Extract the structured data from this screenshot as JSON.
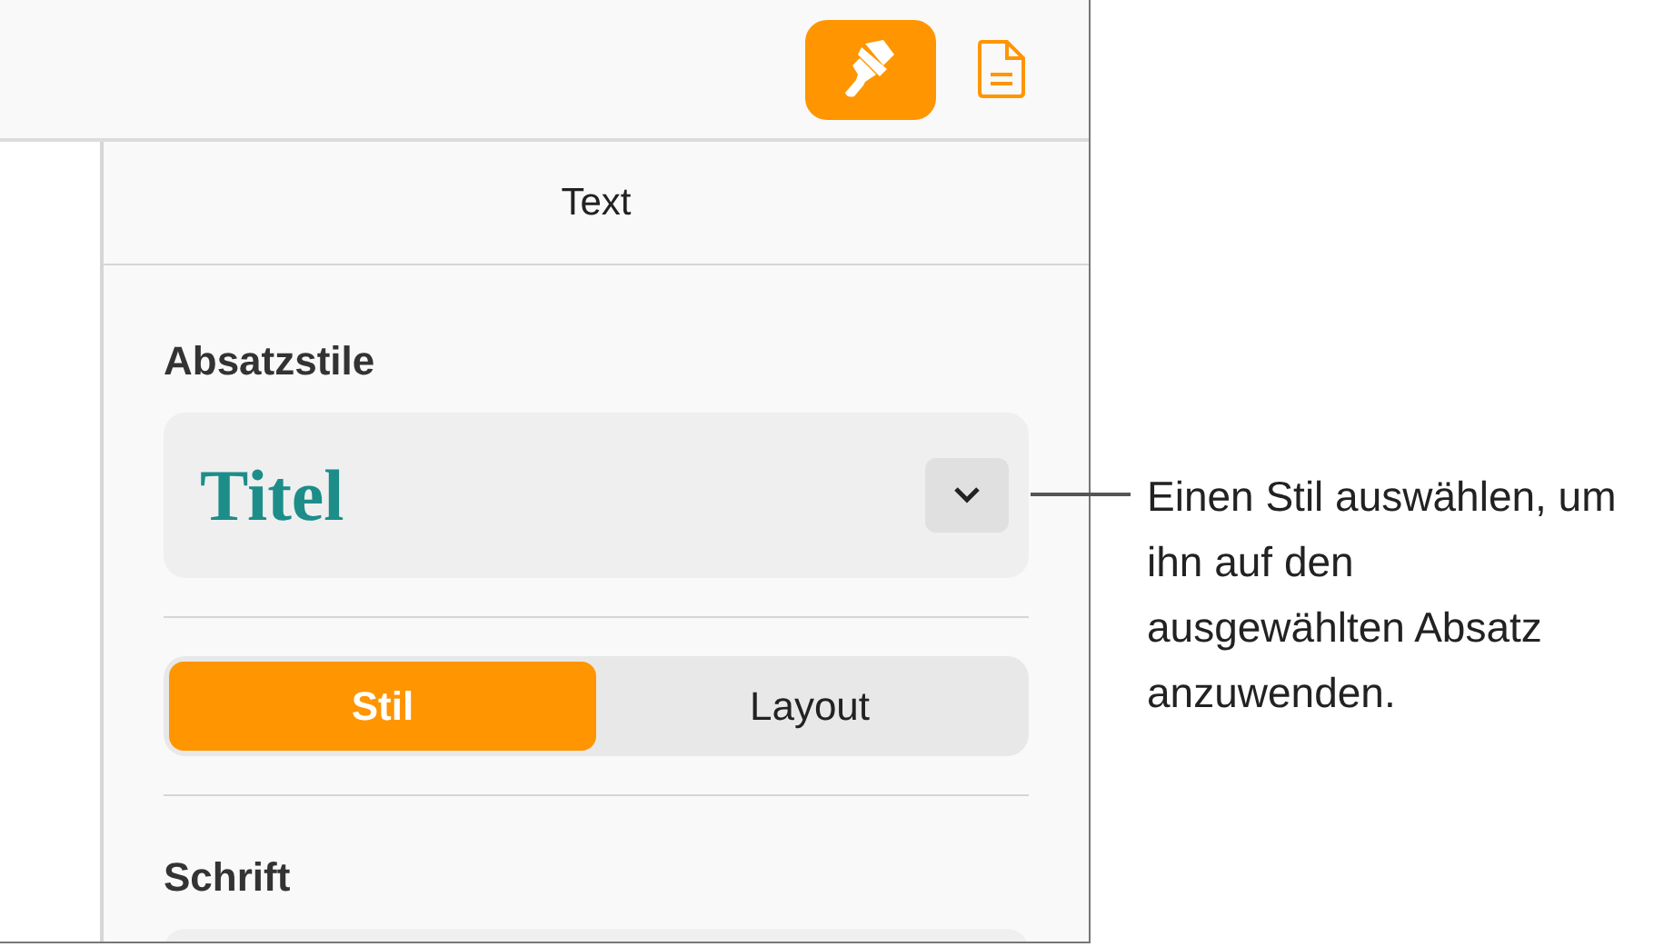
{
  "toolbar": {
    "buttons": [
      {
        "kind": "format",
        "selected": true
      },
      {
        "kind": "document",
        "selected": false
      }
    ]
  },
  "sidebar": {
    "header": "Text",
    "paragraph_styles": {
      "label": "Absatzstile",
      "value": "Titel"
    },
    "segments": [
      {
        "label": "Stil",
        "selected": true
      },
      {
        "label": "Layout",
        "selected": false
      }
    ],
    "font_label": "Schrift"
  },
  "callout": "Einen Stil auswählen, um ihn auf den ausgewählten Absatz anzuwenden."
}
